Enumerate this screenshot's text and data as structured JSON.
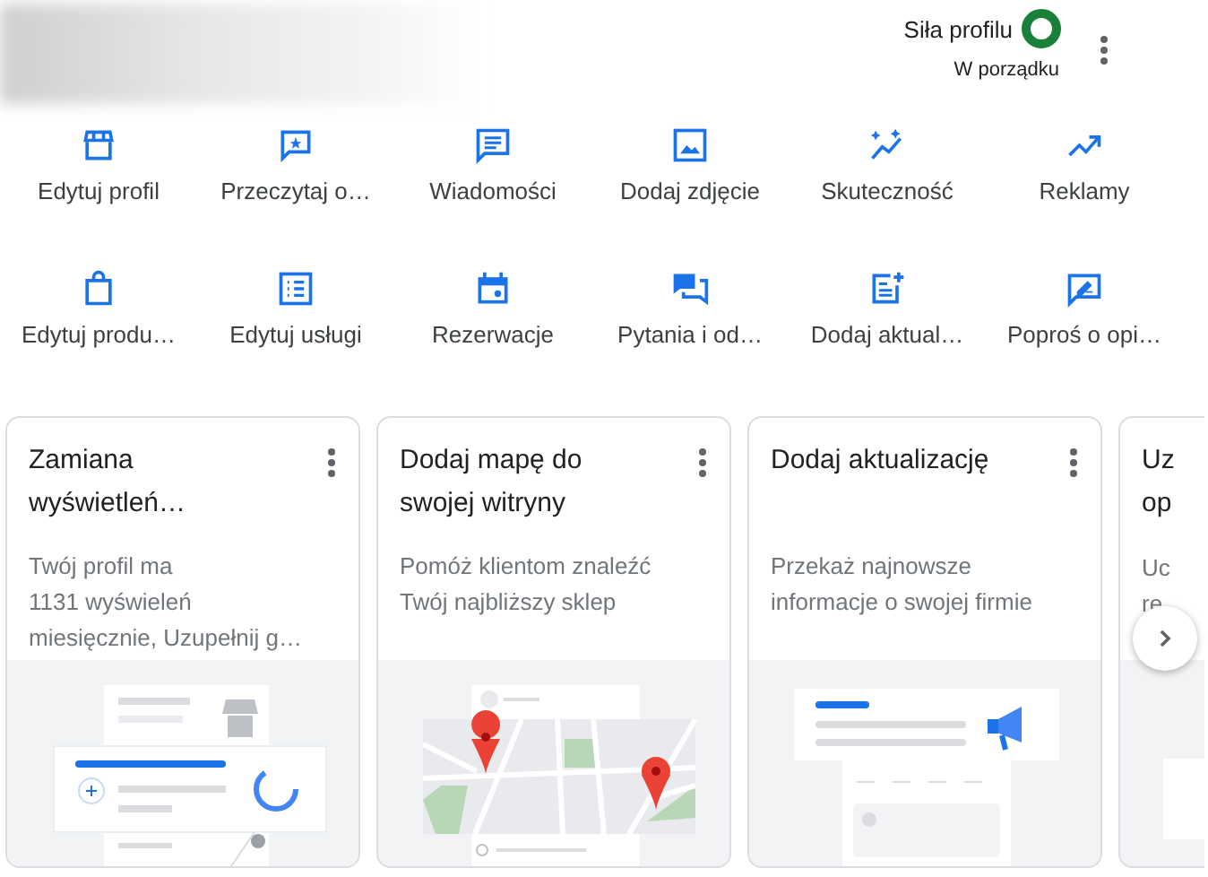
{
  "header": {
    "strength_label": "Siła profilu",
    "strength_status": "W porządku"
  },
  "actions": [
    {
      "label": "Edytuj profil",
      "kind": "store"
    },
    {
      "label": "Przeczytaj o…",
      "kind": "review"
    },
    {
      "label": "Wiadomości",
      "kind": "messages"
    },
    {
      "label": "Dodaj zdjęcie",
      "kind": "photo"
    },
    {
      "label": "Skuteczność",
      "kind": "performance"
    },
    {
      "label": "Reklamy",
      "kind": "ads"
    },
    {
      "label": "Edytuj produ…",
      "kind": "bag"
    },
    {
      "label": "Edytuj usługi",
      "kind": "list"
    },
    {
      "label": "Rezerwacje",
      "kind": "calendar"
    },
    {
      "label": "Pytania i od…",
      "kind": "qa"
    },
    {
      "label": "Dodaj aktual…",
      "kind": "post"
    },
    {
      "label": "Poproś o opi…",
      "kind": "request"
    }
  ],
  "cards": [
    {
      "kind": "profile",
      "title_lines": [
        "Zamiana",
        "wyświetleń…"
      ],
      "description_lines": [
        "Twój profil ma",
        "1131 wyświeleń",
        "miesięcznie, Uzupełnij g…"
      ]
    },
    {
      "kind": "map",
      "title_lines": [
        "Dodaj mapę do",
        "swojej witryny"
      ],
      "description_lines": [
        "Pomóż klientom znaleźć",
        "Twój najbliższy sklep"
      ]
    },
    {
      "kind": "update",
      "title_lines": [
        "Dodaj aktualizację"
      ],
      "description_lines": [
        "Przekaż najnowsze",
        "informacje o swojej firmie"
      ]
    },
    {
      "kind": "partial",
      "title_lines": [
        "Uz",
        "op"
      ],
      "description_lines": [
        "Uc",
        "re"
      ]
    }
  ]
}
